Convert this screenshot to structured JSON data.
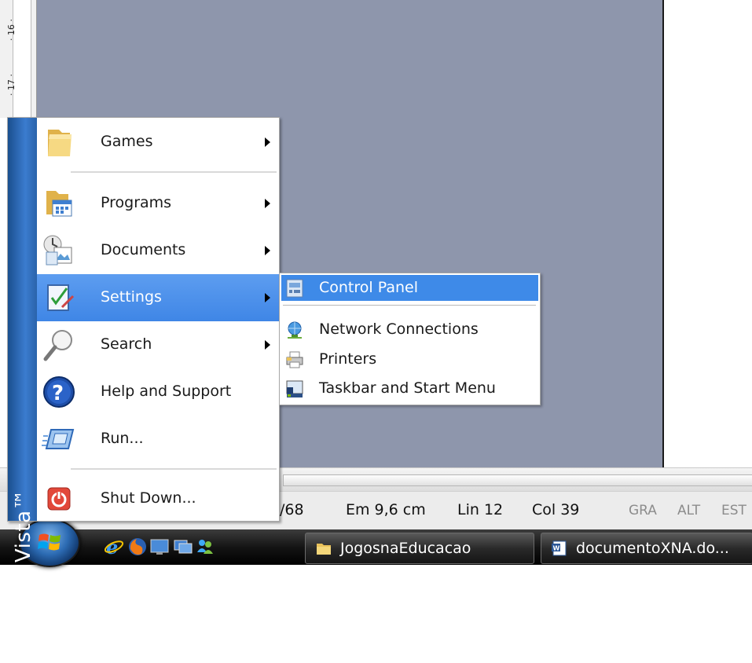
{
  "ruler": {
    "mark_16": "· 16 ·",
    "mark_17": "· 17 ·"
  },
  "start_menu": {
    "brand": "Windows Vista™",
    "items": [
      {
        "label": "Games"
      },
      {
        "label": "Programs"
      },
      {
        "label": "Documents"
      },
      {
        "label": "Settings"
      },
      {
        "label": "Search"
      },
      {
        "label": "Help and Support"
      },
      {
        "label": "Run..."
      },
      {
        "label": "Shut Down..."
      }
    ]
  },
  "settings_submenu": {
    "items": [
      {
        "label": "Control Panel"
      },
      {
        "label": "Network Connections"
      },
      {
        "label": "Printers"
      },
      {
        "label": "Taskbar and Start Menu"
      }
    ]
  },
  "status_bar": {
    "page_fragment": "/68",
    "position": "Em 9,6 cm",
    "line": "Lin 12",
    "column": "Col 39",
    "rec": "GRA",
    "trk": "ALT",
    "ext": "EST"
  },
  "taskbar": {
    "buttons": [
      {
        "label": "JogosnaEducacao"
      },
      {
        "label": "documentoXNA.do..."
      }
    ]
  },
  "colors": {
    "highlight": "#3f86e6",
    "desktop_gray": "#8e96ac",
    "brand_band": "#2a63aa"
  }
}
